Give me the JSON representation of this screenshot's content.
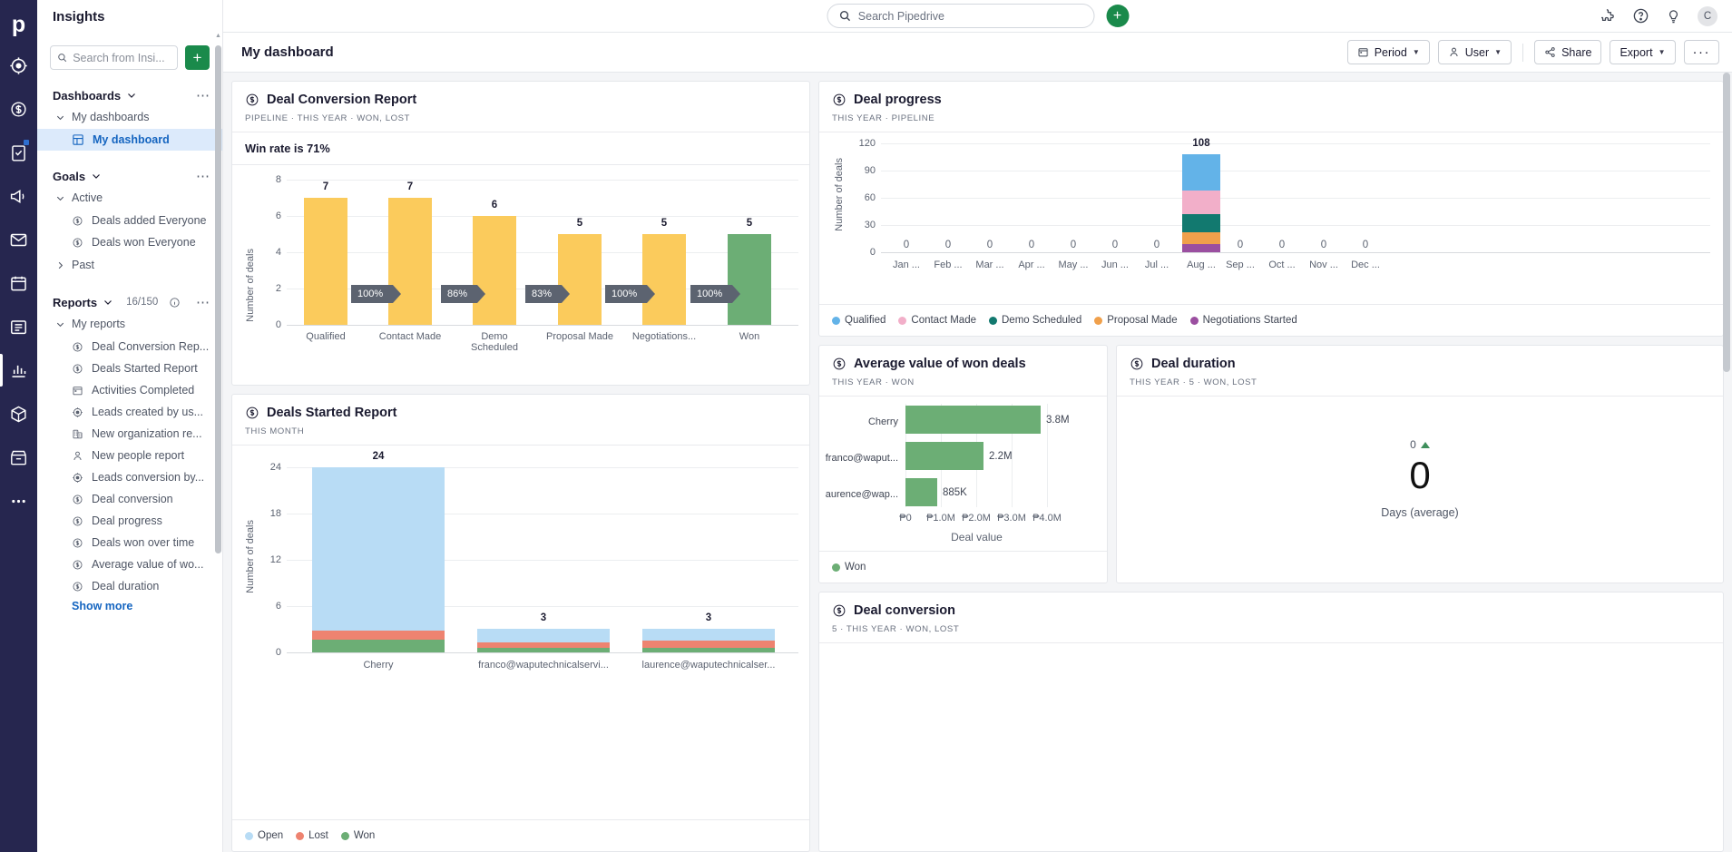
{
  "app": {
    "name": "Insights",
    "logo_letter": "p"
  },
  "rail": {
    "items": [
      {
        "name": "leads-icon",
        "label": "Leads"
      },
      {
        "name": "deals-icon",
        "label": "Deals"
      },
      {
        "name": "activities-icon",
        "label": "Activities"
      },
      {
        "name": "campaigns-icon",
        "label": "Campaigns"
      },
      {
        "name": "mail-icon",
        "label": "Mail"
      },
      {
        "name": "calendar-icon",
        "label": "Calendar"
      },
      {
        "name": "projects-icon",
        "label": "Projects"
      },
      {
        "name": "insights-icon",
        "label": "Insights"
      },
      {
        "name": "products-icon",
        "label": "Products"
      },
      {
        "name": "marketplace-icon",
        "label": "Marketplace"
      },
      {
        "name": "more-icon",
        "label": "More"
      }
    ]
  },
  "search": {
    "sidebar_placeholder": "Search from Insi...",
    "sidebar_value": "",
    "global_placeholder": "Search Pipedrive",
    "global_value": "",
    "add_label": "+"
  },
  "sidebar": {
    "dashboards": {
      "label": "Dashboards",
      "group": "My dashboards",
      "items": [
        {
          "label": "My dashboard",
          "icon": "dashboard-grid-icon",
          "active": true
        }
      ]
    },
    "goals": {
      "label": "Goals",
      "active_group": "Active",
      "past_group": "Past",
      "items": [
        {
          "label": "Deals added Everyone",
          "icon": "deal-coin-icon"
        },
        {
          "label": "Deals won Everyone",
          "icon": "deal-coin-icon"
        }
      ]
    },
    "reports": {
      "label": "Reports",
      "count": "16/150",
      "group": "My reports",
      "show_more": "Show more",
      "items": [
        {
          "label": "Deal Conversion Rep...",
          "icon": "deal-coin-icon"
        },
        {
          "label": "Deals Started Report",
          "icon": "deal-coin-icon"
        },
        {
          "label": "Activities Completed",
          "icon": "calendar-icon"
        },
        {
          "label": "Leads created by us...",
          "icon": "leads-target-icon"
        },
        {
          "label": "New organization re...",
          "icon": "organization-icon"
        },
        {
          "label": "New people report",
          "icon": "person-icon"
        },
        {
          "label": "Leads conversion by...",
          "icon": "leads-target-icon"
        },
        {
          "label": "Deal conversion",
          "icon": "deal-coin-icon"
        },
        {
          "label": "Deal progress",
          "icon": "deal-coin-icon"
        },
        {
          "label": "Deals won over time",
          "icon": "deal-coin-icon"
        },
        {
          "label": "Average value of wo...",
          "icon": "deal-coin-icon"
        },
        {
          "label": "Deal duration",
          "icon": "deal-coin-icon"
        }
      ]
    }
  },
  "toolbar": {
    "page_title": "My dashboard",
    "period_label": "Period",
    "user_label": "User",
    "share_label": "Share",
    "export_label": "Export",
    "more_label": "···"
  },
  "colors": {
    "yellow": "#FBCB5C",
    "green": "#6CAE75",
    "blue": "#63B3E8",
    "pink": "#F2AFC9",
    "teal": "#12796F",
    "orange": "#F0A04B",
    "purple": "#9B4FA0",
    "lightblue": "#B8DCF5",
    "red": "#EE8370",
    "badge_gray": "#5C6370",
    "accent_blue": "#1565c0",
    "brand_navy": "#26264f",
    "add_green": "#1a8a4b"
  },
  "cards": {
    "deal_conversion_report": {
      "title": "Deal Conversion Report",
      "meta": "PIPELINE  ·  THIS YEAR  ·  WON, LOST",
      "win_rate_text": "Win rate is 71%",
      "chart_data": {
        "type": "bar",
        "title": "Deal Conversion Report",
        "xlabel": "",
        "ylabel": "Number of deals",
        "categories": [
          "Qualified",
          "Contact Made",
          "Demo Scheduled",
          "Proposal Made",
          "Negotiations...",
          "Won"
        ],
        "values": [
          7,
          7,
          6,
          5,
          5,
          5
        ],
        "bar_colors": [
          "#FBCB5C",
          "#FBCB5C",
          "#FBCB5C",
          "#FBCB5C",
          "#FBCB5C",
          "#6CAE75"
        ],
        "conversion_labels": [
          "100%",
          "86%",
          "83%",
          "100%",
          "100%"
        ],
        "yticks": [
          0,
          2,
          4,
          6,
          8
        ],
        "ylim": [
          0,
          8
        ],
        "grid": true,
        "legend": null
      }
    },
    "deals_started_report": {
      "title": "Deals Started Report",
      "meta": "THIS MONTH",
      "chart_data": {
        "type": "bar",
        "title": "Deals Started Report",
        "xlabel": "",
        "ylabel": "Number of deals",
        "categories": [
          "Cherry",
          "franco@waputechnicalservi...",
          "laurence@waputechnicalser..."
        ],
        "totals": [
          24,
          3,
          3
        ],
        "series": [
          {
            "name": "Open",
            "color": "#B8DCF5",
            "values": [
              21.2,
              2.0,
              1.8
            ]
          },
          {
            "name": "Lost",
            "color": "#EE8370",
            "values": [
              1.2,
              0.6,
              0.9
            ]
          },
          {
            "name": "Won",
            "color": "#6CAE75",
            "values": [
              1.6,
              0.4,
              0.3
            ]
          }
        ],
        "stacked": true,
        "yticks": [
          0,
          6,
          12,
          18,
          24
        ],
        "ylim": [
          0,
          24
        ],
        "grid": true,
        "legend_position": "bottom",
        "legend": [
          "Open",
          "Lost",
          "Won"
        ]
      }
    },
    "deal_progress": {
      "title": "Deal progress",
      "meta": "THIS YEAR  ·  PIPELINE",
      "chart_data": {
        "type": "bar",
        "title": "Deal progress",
        "xlabel": "",
        "ylabel": "Number of deals",
        "categories": [
          "Jan ...",
          "Feb ...",
          "Mar ...",
          "Apr ...",
          "May ...",
          "Jun ...",
          "Jul ...",
          "Aug ...",
          "Sep ...",
          "Oct ...",
          "Nov ...",
          "Dec ..."
        ],
        "totals": [
          0,
          0,
          0,
          0,
          0,
          0,
          0,
          108,
          0,
          0,
          0,
          0
        ],
        "stacked": true,
        "series": [
          {
            "name": "Qualified",
            "color": "#63B3E8",
            "values": [
              0,
              0,
              0,
              0,
              0,
              0,
              0,
              44,
              0,
              0,
              0,
              0
            ]
          },
          {
            "name": "Contact Made",
            "color": "#F2AFC9",
            "values": [
              0,
              0,
              0,
              0,
              0,
              0,
              0,
              26,
              0,
              0,
              0,
              0
            ]
          },
          {
            "name": "Demo Scheduled",
            "color": "#12796F",
            "values": [
              0,
              0,
              0,
              0,
              0,
              0,
              0,
              22,
              0,
              0,
              0,
              0
            ]
          },
          {
            "name": "Proposal Made",
            "color": "#F0A04B",
            "values": [
              0,
              0,
              0,
              0,
              0,
              0,
              0,
              9,
              0,
              0,
              0,
              0
            ]
          },
          {
            "name": "Negotiations Started",
            "color": "#9B4FA0",
            "values": [
              0,
              0,
              0,
              0,
              0,
              0,
              0,
              7,
              0,
              0,
              0,
              0
            ]
          }
        ],
        "yticks": [
          0,
          30,
          60,
          90,
          120
        ],
        "ylim": [
          0,
          120
        ],
        "grid": true,
        "legend_position": "bottom",
        "legend": [
          "Qualified",
          "Contact Made",
          "Demo Scheduled",
          "Proposal Made",
          "Negotiations Started"
        ]
      }
    },
    "average_value_won_deals": {
      "title": "Average value of won deals",
      "meta": "THIS YEAR  ·  WON",
      "legend": [
        "Won"
      ],
      "chart_data": {
        "type": "bar",
        "orientation": "horizontal",
        "title": "Average value of won deals",
        "xlabel": "Deal value",
        "ylabel": "",
        "categories": [
          "Cherry",
          "franco@waput...",
          "aurence@wap..."
        ],
        "values": [
          3800000,
          2200000,
          885000
        ],
        "value_labels": [
          "3.8M",
          "2.2M",
          "885K"
        ],
        "xticks": [
          "₱0",
          "₱1.0M",
          "₱2.0M",
          "₱3.0M",
          "₱4.0M"
        ],
        "xlim": [
          0,
          4000000
        ],
        "bar_color": "#6CAE75",
        "grid": true,
        "legend_position": "bottom"
      }
    },
    "deal_duration": {
      "title": "Deal duration",
      "meta": "THIS YEAR  ·  5  ·  WON, LOST",
      "chart_data": {
        "type": "scorecard",
        "title": "Deal duration",
        "delta_value": "0",
        "delta_direction": "up",
        "value": "0",
        "unit_label": "Days (average)"
      }
    },
    "deal_conversion": {
      "title": "Deal conversion",
      "meta": "5  ·  THIS YEAR  ·  WON, LOST"
    }
  }
}
